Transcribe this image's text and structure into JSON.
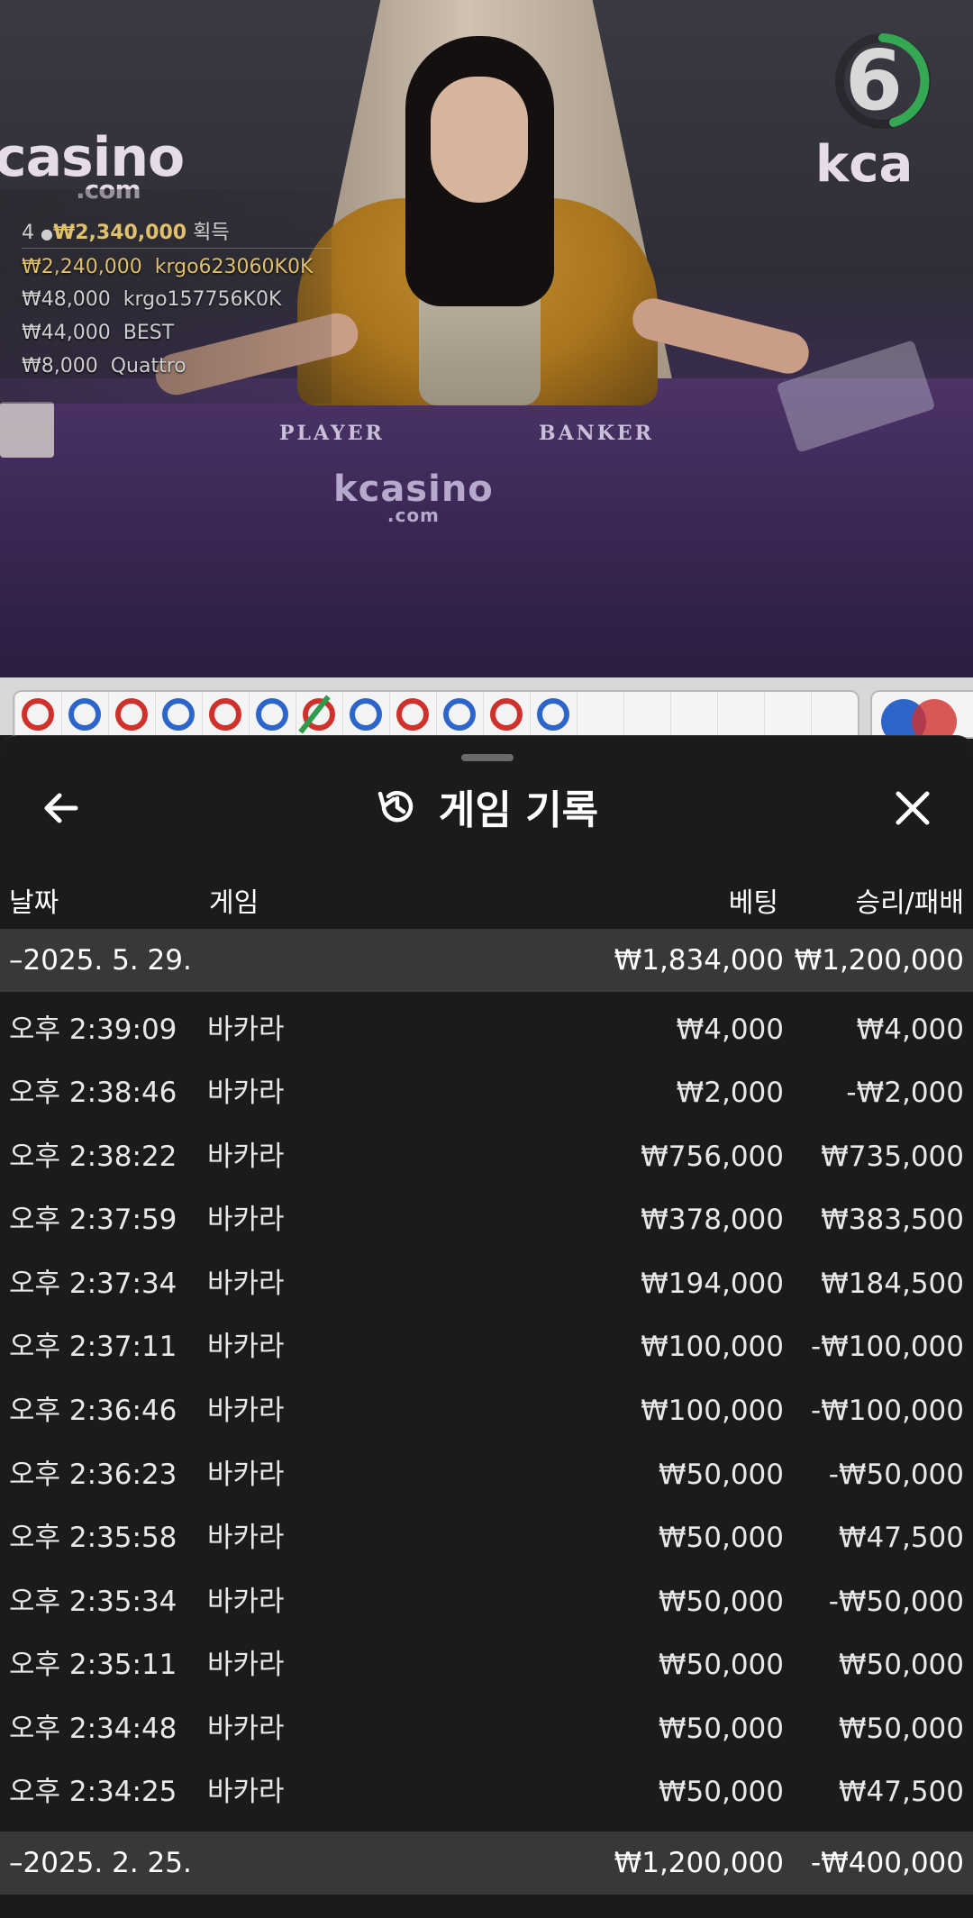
{
  "video": {
    "brand_left": "casino",
    "brand_left_sub": ".com",
    "brand_right": "kca",
    "timer": "6",
    "table_player_label": "PLAYER",
    "table_banker_label": "BANKER",
    "felt_brand": "kcasino",
    "felt_brand_sub": ".com",
    "winners": {
      "count": "4",
      "total": "₩2,340,000",
      "total_suffix": "획득",
      "entries": [
        {
          "amount": "₩2,240,000",
          "name": "krgo623060K0K"
        },
        {
          "amount": "₩48,000",
          "name": "krgo157756K0K"
        },
        {
          "amount": "₩44,000",
          "name": "BEST"
        },
        {
          "amount": "₩8,000",
          "name": "Quattro"
        }
      ]
    }
  },
  "road": {
    "beads": [
      "r",
      "b",
      "r",
      "b",
      "r",
      "b",
      "r",
      "b",
      "r",
      "b",
      "r",
      "b"
    ],
    "colors": {
      "player": "#2d65c8",
      "banker": "#d0312d",
      "tie": "#2e9a4b"
    }
  },
  "sheet": {
    "title": "게임 기록",
    "columns": {
      "date": "날짜",
      "game": "게임",
      "bet": "베팅",
      "result": "승리/패배"
    },
    "groups": [
      {
        "date": "–2025. 5. 29.",
        "bet_total": "₩1,834,000",
        "result_total": "₩1,200,000",
        "rows": [
          {
            "time": "오후 2:39:09",
            "game": "바카라",
            "bet": "₩4,000",
            "result": "₩4,000"
          },
          {
            "time": "오후 2:38:46",
            "game": "바카라",
            "bet": "₩2,000",
            "result": "-₩2,000"
          },
          {
            "time": "오후 2:38:22",
            "game": "바카라",
            "bet": "₩756,000",
            "result": "₩735,000"
          },
          {
            "time": "오후 2:37:59",
            "game": "바카라",
            "bet": "₩378,000",
            "result": "₩383,500"
          },
          {
            "time": "오후 2:37:34",
            "game": "바카라",
            "bet": "₩194,000",
            "result": "₩184,500"
          },
          {
            "time": "오후 2:37:11",
            "game": "바카라",
            "bet": "₩100,000",
            "result": "-₩100,000"
          },
          {
            "time": "오후 2:36:46",
            "game": "바카라",
            "bet": "₩100,000",
            "result": "-₩100,000"
          },
          {
            "time": "오후 2:36:23",
            "game": "바카라",
            "bet": "₩50,000",
            "result": "-₩50,000"
          },
          {
            "time": "오후 2:35:58",
            "game": "바카라",
            "bet": "₩50,000",
            "result": "₩47,500"
          },
          {
            "time": "오후 2:35:34",
            "game": "바카라",
            "bet": "₩50,000",
            "result": "-₩50,000"
          },
          {
            "time": "오후 2:35:11",
            "game": "바카라",
            "bet": "₩50,000",
            "result": "₩50,000"
          },
          {
            "time": "오후 2:34:48",
            "game": "바카라",
            "bet": "₩50,000",
            "result": "₩50,000"
          },
          {
            "time": "오후 2:34:25",
            "game": "바카라",
            "bet": "₩50,000",
            "result": "₩47,500"
          }
        ]
      },
      {
        "date": "–2025. 2. 25.",
        "bet_total": "₩1,200,000",
        "result_total": "-₩400,000",
        "rows": []
      }
    ]
  }
}
